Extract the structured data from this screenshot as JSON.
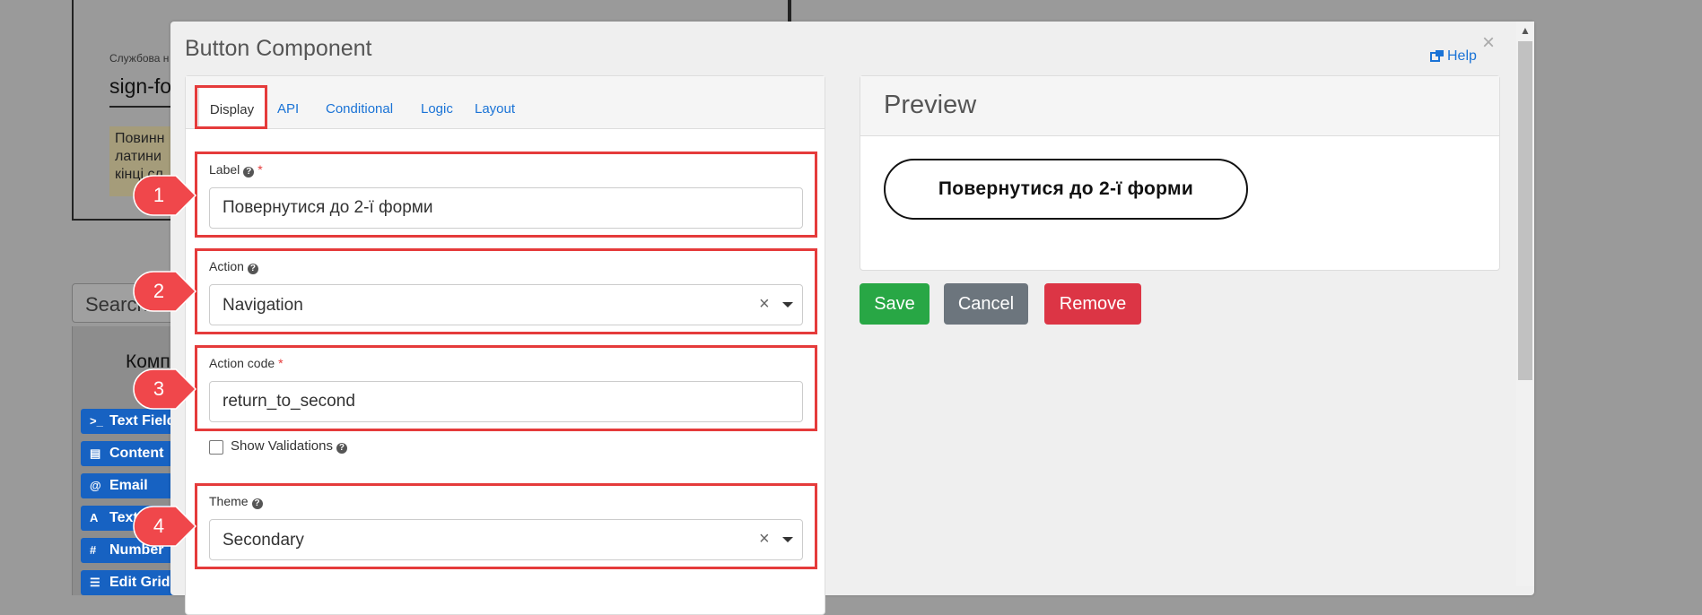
{
  "background": {
    "service_label": "Службова н",
    "form_name": "sign-fo",
    "hint_text": "Повинн\nлатини\nкінці сл",
    "search_placeholder": "Search fi",
    "panel_title": "Комп",
    "components": [
      {
        "icon": ">_",
        "label": "Text Field"
      },
      {
        "icon": "▤",
        "label": "Content"
      },
      {
        "icon": "@",
        "label": "Email"
      },
      {
        "icon": "A",
        "label": "Text"
      },
      {
        "icon": "#",
        "label": "Number"
      },
      {
        "icon": "☰",
        "label": "Edit Grid"
      }
    ]
  },
  "modal": {
    "title": "Button Component",
    "close": "×",
    "help": "Help",
    "tabs": [
      {
        "label": "Display",
        "active": true
      },
      {
        "label": "API"
      },
      {
        "label": "Conditional"
      },
      {
        "label": "Logic"
      },
      {
        "label": "Layout"
      }
    ],
    "fields": {
      "label": {
        "label": "Label",
        "required_mark": "*",
        "value": "Повернутися до 2-ї форми"
      },
      "action": {
        "label": "Action",
        "value": "Navigation",
        "clear": "×"
      },
      "action_code": {
        "label": "Action code",
        "required_mark": "*",
        "value": "return_to_second"
      },
      "show_validations": {
        "label": "Show Validations",
        "checked": false
      },
      "theme": {
        "label": "Theme",
        "value": "Secondary",
        "clear": "×"
      }
    },
    "preview": {
      "title": "Preview",
      "button_label": "Повернутися до 2-ї форми"
    },
    "actions": {
      "save": "Save",
      "cancel": "Cancel",
      "remove": "Remove"
    }
  },
  "markers": [
    "1",
    "2",
    "3",
    "4"
  ],
  "colors": {
    "link": "#1a73d6",
    "highlight": "#e53b3b",
    "save": "#28a745",
    "cancel": "#6c757d",
    "remove": "#dc3545",
    "marker": "#f0474b"
  }
}
